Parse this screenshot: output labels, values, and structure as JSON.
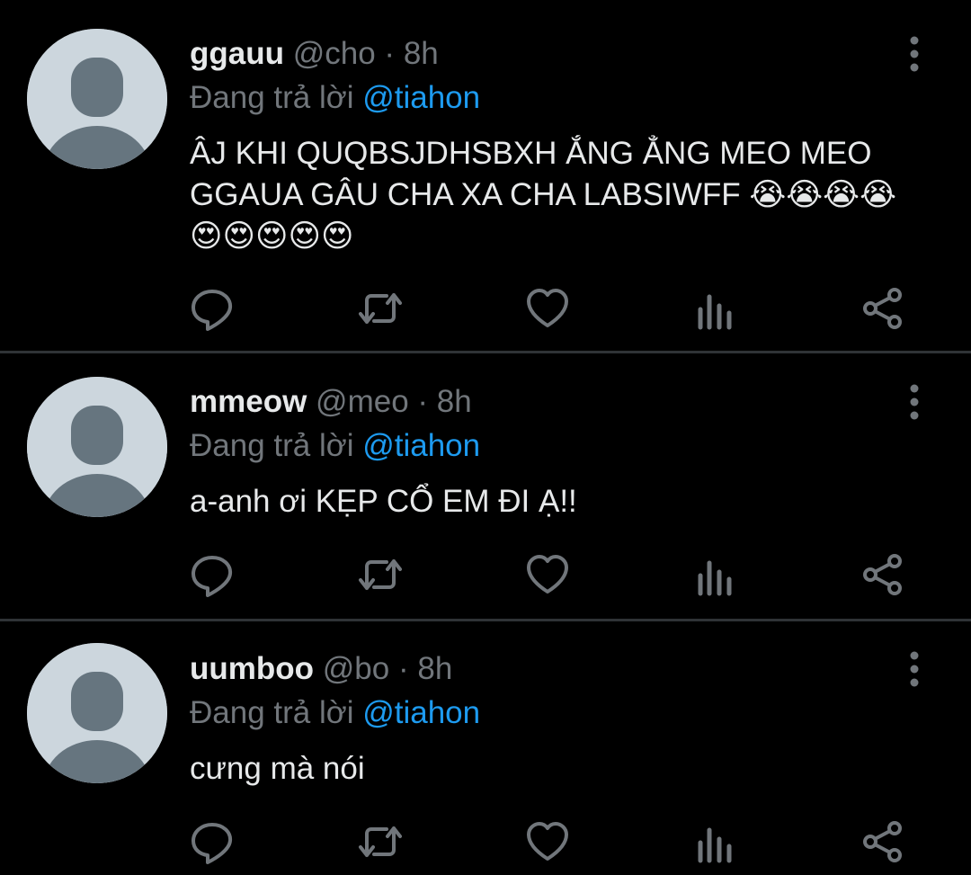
{
  "tweets": [
    {
      "name": "ggauu",
      "handle": "@cho",
      "separator": "·",
      "time": "8h",
      "reply_prefix": "Đang trả lời",
      "reply_to": "@tiahon",
      "text": "ÂJ KHI QUQBSJDHSBXH ẮNG ẲNG MEO MEO GGAUA GÂU CHA XA CHA LABSIWFF 😭😭😭😭 😍😍😍😍😍"
    },
    {
      "name": "mmeow",
      "handle": "@meo",
      "separator": "·",
      "time": "8h",
      "reply_prefix": "Đang trả lời",
      "reply_to": "@tiahon",
      "text": "a-anh ơi KẸP CỔ EM ĐI Ạ!!"
    },
    {
      "name": "uumboo",
      "handle": "@bo",
      "separator": "·",
      "time": "8h",
      "reply_prefix": "Đang trả lời",
      "reply_to": "@tiahon",
      "text": "cưng mà nói"
    }
  ],
  "icons": {
    "reply": "reply-icon",
    "retweet": "retweet-icon",
    "like": "heart-icon",
    "analytics": "analytics-icon",
    "share": "share-icon",
    "more": "more-vertical-icon",
    "avatar": "default-avatar-icon"
  },
  "colors": {
    "background": "#000000",
    "text": "#e7e9ea",
    "muted": "#71767b",
    "link": "#1d9bf0",
    "divider": "#2f3336",
    "avatar_bg": "#ccd6dd",
    "avatar_fg": "#66757f"
  }
}
